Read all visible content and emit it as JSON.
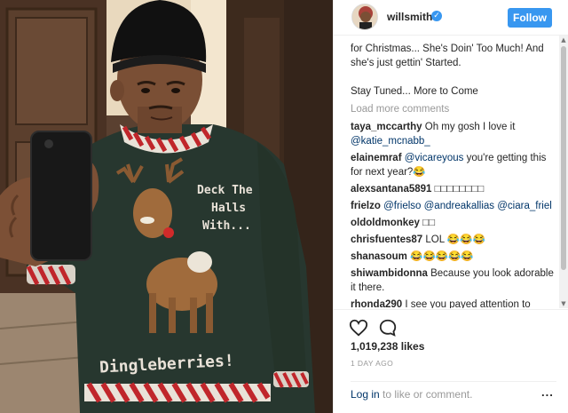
{
  "post": {
    "username": "willsmith",
    "verified_icon": "verified-badge-icon",
    "follow_label": "Follow"
  },
  "caption": {
    "line1": "for Christmas... She's Doin' Too Much! And",
    "line2": "she's just gettin' Started.",
    "line3": "Stay Tuned... More to Come"
  },
  "load_more": "Load more comments",
  "comments": [
    {
      "user": "taya_mccarthy",
      "text": "Oh my gosh I love it",
      "mention": "@katie_mcnabb_",
      "after": ""
    },
    {
      "user": "elainemraf",
      "text": "",
      "mention": "@vicareyous",
      "after": "you're getting this for next year?😂"
    },
    {
      "user": "alexsantana5891",
      "text": "□□□□□□□□",
      "mention": "",
      "after": ""
    },
    {
      "user": "frielzo",
      "text": "",
      "mention": "@frielso @andreakallias @ciara_friel",
      "after": ""
    },
    {
      "user": "oldoldmonkey",
      "text": "□□",
      "mention": "",
      "after": ""
    },
    {
      "user": "chrisfuentes87",
      "text": "LOL 😂😂😂",
      "mention": "",
      "after": ""
    },
    {
      "user": "shanasoum",
      "text": "😂😂😂😂😂",
      "mention": "",
      "after": ""
    },
    {
      "user": "shiwambidonna",
      "text": "Because you look adorable it there.",
      "mention": "",
      "after": ""
    },
    {
      "user": "rhonda290",
      "text": "I see you payed attention to",
      "mention": "",
      "after": ""
    }
  ],
  "actions": {
    "like_icon": "heart-icon",
    "comment_icon": "speech-bubble-icon",
    "likes": "1,019,238 likes",
    "time": "1 DAY AGO",
    "login_link": "Log in",
    "login_rest": " to like or comment.",
    "more_icon": "more-options-icon",
    "more_label": "..."
  },
  "sweater": {
    "text1": "Deck The",
    "text2": "Halls",
    "text3": "With...",
    "bottom": "Dingleberries!"
  },
  "colors": {
    "accent": "#3897f0",
    "link": "#003569",
    "muted": "#999999",
    "sweater": "#27372f"
  }
}
